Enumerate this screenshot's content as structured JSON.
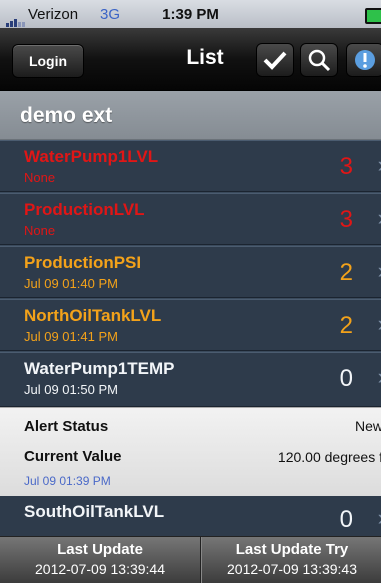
{
  "status_bar": {
    "carrier": "Verizon",
    "network": "3G",
    "time": "1:39 PM"
  },
  "nav": {
    "back_label": "Login",
    "title": "List"
  },
  "section_title": "demo ext",
  "rows": [
    {
      "name": "WaterPump1LVL",
      "sub": "None",
      "count": "3"
    },
    {
      "name": "ProductionLVL",
      "sub": "None",
      "count": "3"
    },
    {
      "name": "ProductionPSI",
      "sub": "Jul 09 01:40 PM",
      "count": "2"
    },
    {
      "name": "NorthOilTankLVL",
      "sub": "Jul 09 01:41 PM",
      "count": "2"
    },
    {
      "name": "WaterPump1TEMP",
      "sub": "Jul 09 01:50 PM",
      "count": "0"
    }
  ],
  "detail": {
    "alert_status_label": "Alert Status",
    "alert_status_value": "New",
    "current_value_label": "Current Value",
    "current_value": "120.00 degrees f",
    "timestamp": "Jul 09 01:39 PM"
  },
  "partial_row": {
    "name": "SouthOilTankLVL",
    "count": "0"
  },
  "toolbar": {
    "last_update_label": "Last Update",
    "last_update_value": "2012-07-09 13:39:44",
    "last_try_label": "Last Update Try",
    "last_try_value": "2012-07-09 13:39:43"
  },
  "colors": {
    "critical": "#e01616",
    "warning": "#f3a21a",
    "normal": "#f2f5f8",
    "row_bg": "#2e3b4b"
  }
}
